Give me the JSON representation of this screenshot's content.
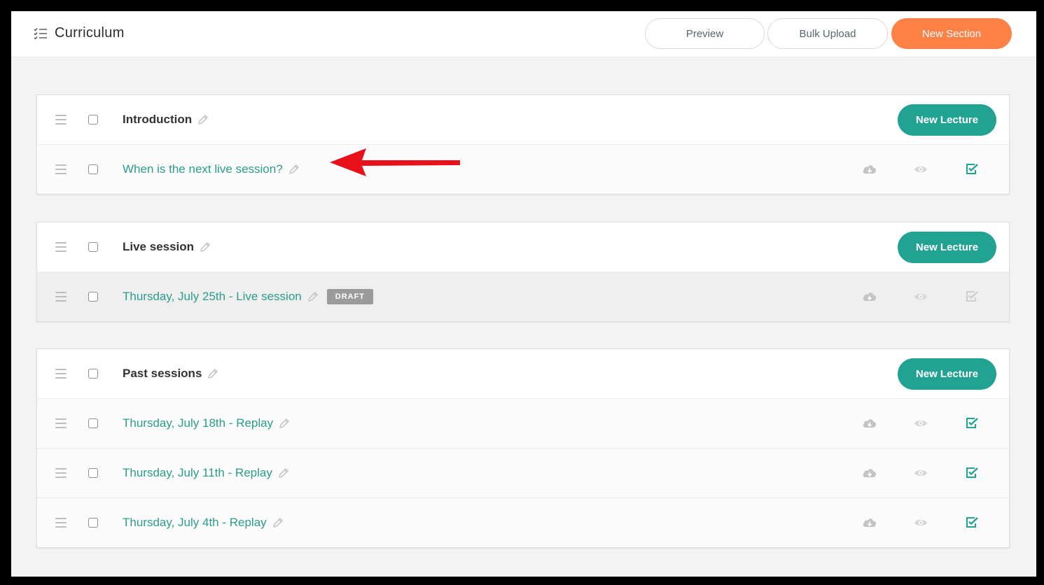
{
  "header": {
    "title": "Curriculum",
    "preview_label": "Preview",
    "bulk_upload_label": "Bulk Upload",
    "new_section_label": "New Section"
  },
  "new_lecture_label": "New Lecture",
  "sections": [
    {
      "title": "Introduction",
      "lectures": [
        {
          "title": "When is the next live session?",
          "published": true
        }
      ]
    },
    {
      "title": "Live session",
      "lectures": [
        {
          "title": "Thursday, July 25th - Live session",
          "badge": "DRAFT",
          "published": false
        }
      ]
    },
    {
      "title": "Past sessions",
      "lectures": [
        {
          "title": "Thursday, July 18th - Replay",
          "published": true
        },
        {
          "title": "Thursday, July 11th - Replay",
          "published": true
        },
        {
          "title": "Thursday, July 4th - Replay",
          "published": true
        }
      ]
    }
  ],
  "icons": {
    "title": "checklist-icon",
    "drag": "drag-handle-icon",
    "edit": "pencil-icon",
    "download": "cloud-download-icon",
    "preview": "eye-icon",
    "publish": "check-square-icon",
    "annotation": "red-arrow-annotation"
  },
  "colors": {
    "accent_teal": "#22a293",
    "accent_orange": "#ff8146",
    "lecture_text": "#2a9d8c",
    "annotation_red": "#e8101b"
  }
}
